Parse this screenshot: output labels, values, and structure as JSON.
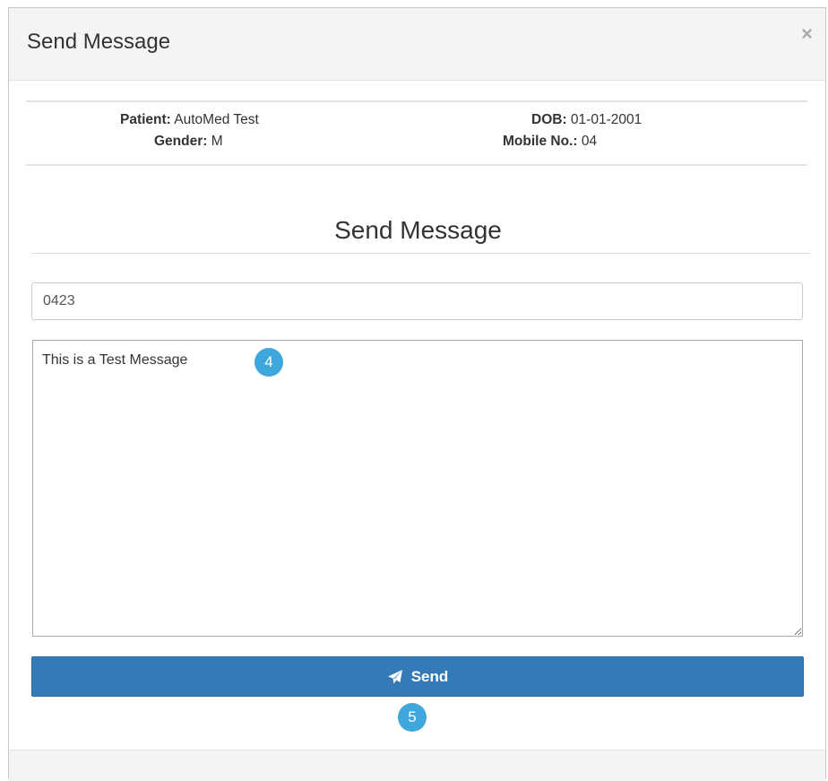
{
  "modal": {
    "title": "Send Message",
    "close_label": "×"
  },
  "patient_info": {
    "patient_label": "Patient:",
    "patient_value": "AutoMed Test",
    "gender_label": "Gender:",
    "gender_value": "M",
    "dob_label": "DOB:",
    "dob_value": "01-01-2001",
    "mobile_label": "Mobile No.:",
    "mobile_value": "04"
  },
  "form": {
    "section_title": "Send Message",
    "phone_value": "0423",
    "message_value": "This is a Test Message",
    "send_label": "Send",
    "send_icon": "paper-plane-icon"
  },
  "annotations": {
    "marker_1": "4",
    "marker_2": "5"
  },
  "colors": {
    "primary_button": "#337ab7",
    "step_marker": "#3fa7dc"
  }
}
